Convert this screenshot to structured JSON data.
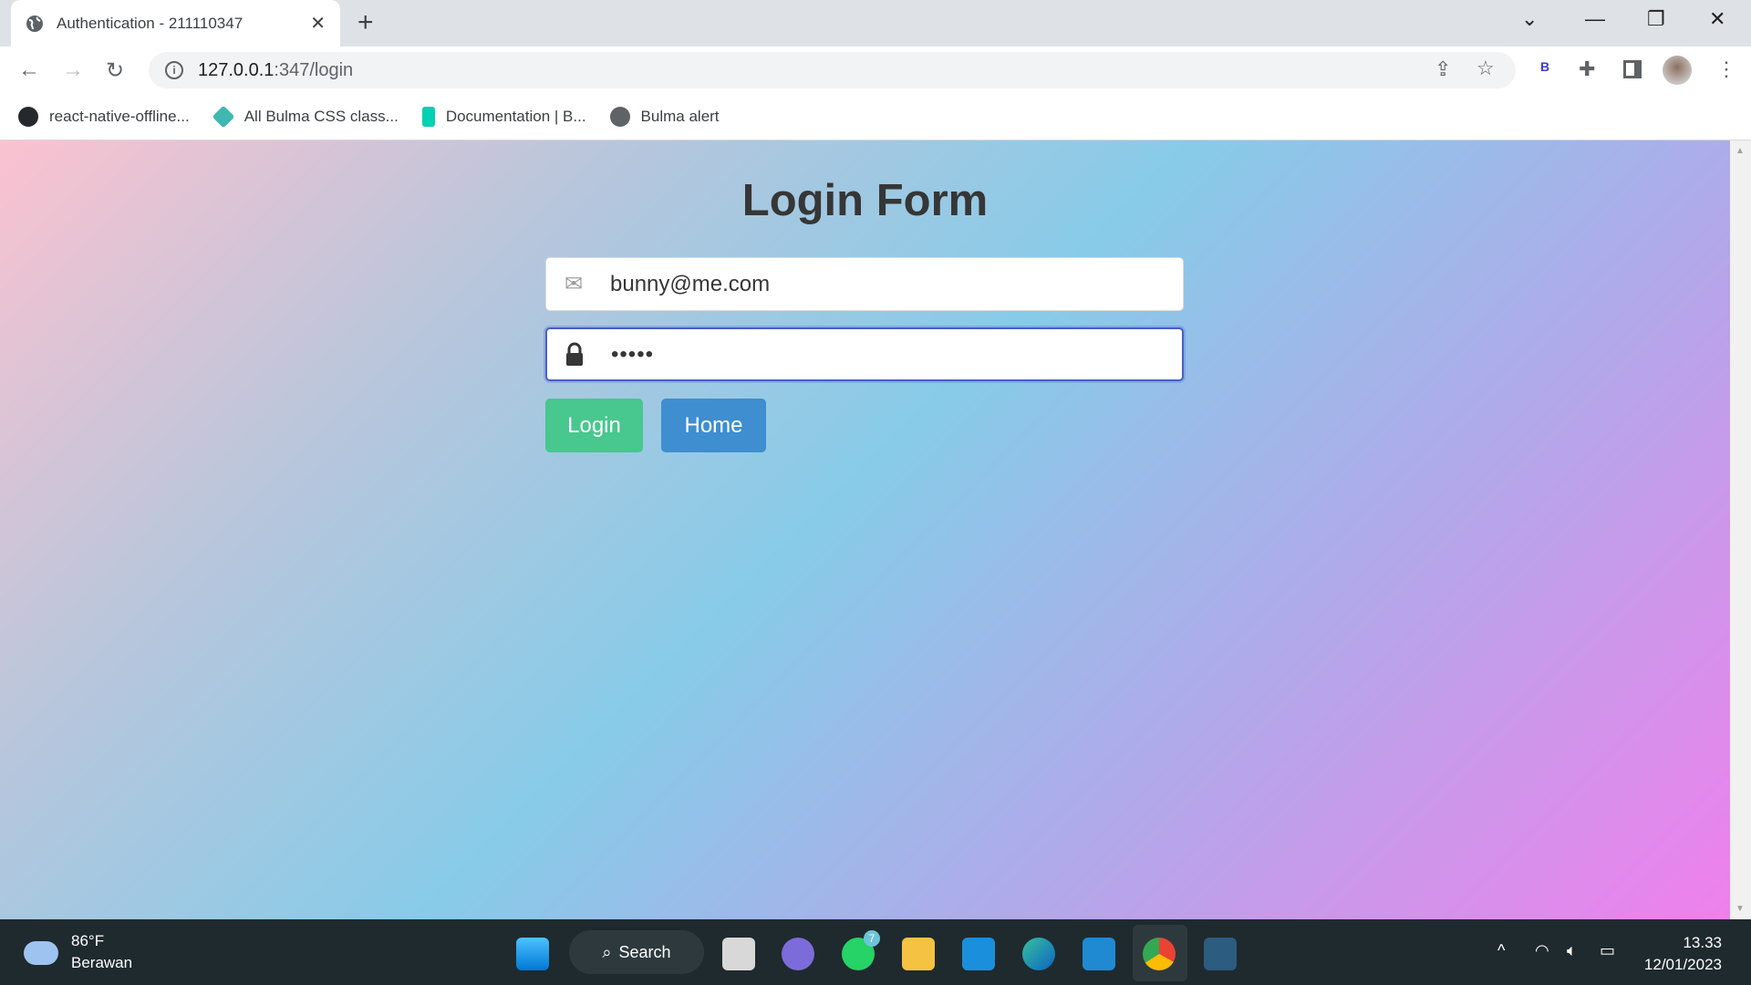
{
  "browser": {
    "tab_title": "Authentication - 211110347",
    "url_host": "127.0.0.1",
    "url_path": ":347/login",
    "extension_label": "B",
    "bookmarks": [
      {
        "label": "react-native-offline...",
        "icon": "github-icon"
      },
      {
        "label": "All Bulma CSS class...",
        "icon": "bulma-stack-icon"
      },
      {
        "label": "Documentation | B...",
        "icon": "bulma-logo-icon"
      },
      {
        "label": "Bulma alert",
        "icon": "globe-icon"
      }
    ]
  },
  "page": {
    "title": "Login Form",
    "email_value": "bunny@me.com",
    "password_value": "•••••",
    "login_label": "Login",
    "home_label": "Home",
    "colors": {
      "login": "#48c78e",
      "home": "#3e8ed0",
      "focus": "#485fc7"
    }
  },
  "taskbar": {
    "temperature": "86°F",
    "weather": "Berawan",
    "search_label": "Search",
    "whatsapp_badge": "7",
    "time": "13.33",
    "date": "12/01/2023"
  }
}
